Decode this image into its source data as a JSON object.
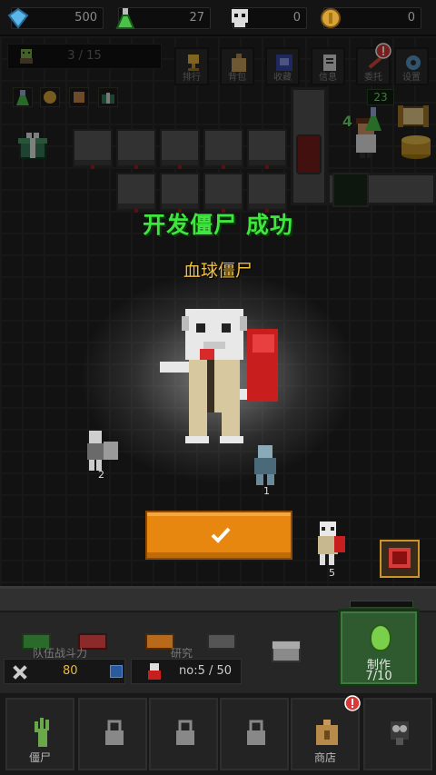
{
  "resources": {
    "gems": "500",
    "potion": "27",
    "skulls": "0",
    "coins": "0"
  },
  "population": "3 / 15",
  "menu": [
    {
      "key": "rank",
      "label": "排行"
    },
    {
      "key": "bag",
      "label": "背包"
    },
    {
      "key": "collection",
      "label": "收藏"
    },
    {
      "key": "info",
      "label": "信息"
    },
    {
      "key": "commission",
      "label": "委托"
    },
    {
      "key": "settings",
      "label": "设置"
    }
  ],
  "counters": {
    "top_right": "23",
    "lab_level": "4"
  },
  "popup": {
    "title": "开发僵尸 成功",
    "zombie_name": "血球僵尸"
  },
  "stage_zombie_levels": {
    "left": "2",
    "middle": "1",
    "right": "5"
  },
  "bottom": {
    "team_power_label": "队伍战斗力",
    "research_label": "研究",
    "power_value": "80",
    "research_value": "no:5 / 50",
    "produce_label": "制作",
    "produce_count": "7/10"
  },
  "tabs": [
    {
      "key": "zombie",
      "label": "僵尸"
    },
    {
      "key": "locked1",
      "label": ""
    },
    {
      "key": "locked2",
      "label": ""
    },
    {
      "key": "locked3",
      "label": ""
    },
    {
      "key": "shop",
      "label": "商店"
    },
    {
      "key": "boss",
      "label": ""
    }
  ],
  "colors": {
    "success_green": "#3ee63e",
    "name_gold": "#f0c040",
    "confirm_orange": "#e8870f"
  }
}
